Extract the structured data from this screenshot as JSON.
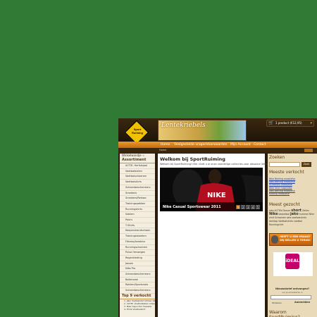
{
  "header": {
    "logo_text": "Sport Ruiming",
    "banner_text": "Lentekriebels",
    "cart": {
      "text": "1 product (€12,95)",
      "icon": "cart-icon"
    }
  },
  "nav": {
    "items": [
      "Home",
      "Veelgestelde vragen",
      "Voorwaarden",
      "Mijn Account",
      "Contact"
    ]
  },
  "breadcrumb": "Home",
  "sidebar": {
    "welcome": "Winkelwandje ☆",
    "assortiment_title": "Assortiment",
    "items": [
      "ACTIE: Herfstsjaal",
      "Voetbalballen",
      "Voetbalschoenen",
      "Voetbalshirts",
      "Scheenbeschermers",
      "Sneakers",
      "Sneakers/Reiswo",
      "Trainingspakken",
      "Runningshirts",
      "Sokken",
      "Polo's",
      "T-Shirts",
      "Keepershandschoen",
      "Trainingsbroeken",
      "Fitness/Aerobics",
      "Runningschoenen",
      "Pulse Herwegen",
      "Regenkleding",
      "Jassen",
      "Nike Pro",
      "Scheenbeschermers",
      "Balkenzak",
      "Rokken/Sportcosts",
      "Scheenbeschermers"
    ],
    "top9_title": "Top 9 verkocht",
    "top9": [
      "1. Jako Voetbalshirt Striker KZ05",
      "2. ACTIE: Voetbalballen Adipure 5/9",
      "3. Nike Capuchon Sweater",
      "4. Ehrla Voetbalshirt"
    ]
  },
  "main": {
    "title": "Welkom bij SportRuiming",
    "intro": "Welkom bij SportRuiming! Hier vindt u al onze voordelige collecties voor absolute liefhebbers.",
    "slide_caption": "Nike Casual Sportswear 2011",
    "slide_label": "NIKE",
    "pages": [
      "1",
      "2",
      "3",
      "4",
      "5"
    ],
    "active_page": "1"
  },
  "right": {
    "search_title": "Zoeken",
    "search_button": "Zoek",
    "best_title": "Meeste verkocht",
    "best": [
      "Nike Bierling maat/ofse",
      "Jako Bierling maat/ofse",
      "Schoenen maat/ofse",
      "Nike Shirt maat/ofse",
      "Jako Bierling maat/ofse",
      "Kleding maat/ofse"
    ],
    "tags_title": "Meest gezocht",
    "tags_text": "jako ACTIEd Taxum",
    "tag_big1": "short",
    "tag_mid": "Zeilen",
    "tag_big2": "Nike",
    "tags_text2": "basketbal",
    "tag_big3": "jako",
    "tag_mid2": "hummel",
    "tags_text3": "Nike shirt Schoenen sets voetbalshirts tanktop Voetbalshirts voetbal Runningshirt",
    "ad_line1": "HEEFT U EEN VRAAG?",
    "ad_line2": "WIJ BELLEN U TERUG!",
    "ideal_logo": "iDEAL",
    "login_title": "Nieuwsbrief ontvangen?",
    "login_sub": "vul je emailadres in",
    "login_link": "Winkelen",
    "login_button": "Aanmelden",
    "why_title": "Waarom SportRuiming?"
  },
  "colors": {
    "accent": "#e87f14",
    "background": "#2f7a34",
    "brand_dark": "#2a1c0c"
  }
}
